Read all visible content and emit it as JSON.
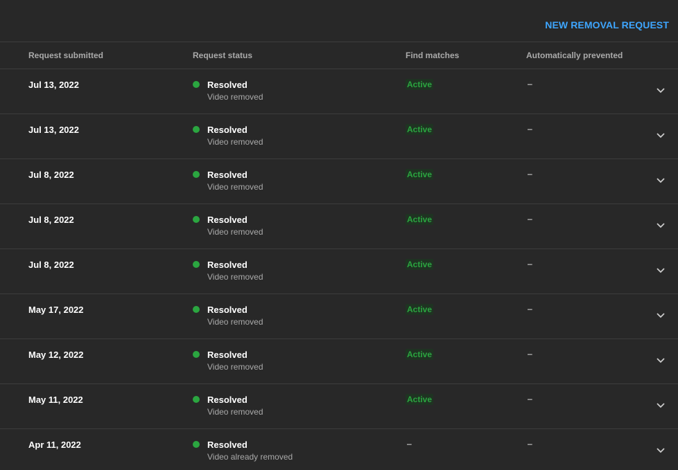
{
  "toolbar": {
    "new_request_label": "NEW REMOVAL REQUEST"
  },
  "table": {
    "columns": [
      "Request submitted",
      "Request status",
      "Find matches",
      "Automatically prevented"
    ],
    "rows": [
      {
        "date": "Jul 13, 2022",
        "status": "Resolved",
        "detail": "Video removed",
        "find_matches": "Active",
        "auto_prevented": "–"
      },
      {
        "date": "Jul 13, 2022",
        "status": "Resolved",
        "detail": "Video removed",
        "find_matches": "Active",
        "auto_prevented": "–"
      },
      {
        "date": "Jul 8, 2022",
        "status": "Resolved",
        "detail": "Video removed",
        "find_matches": "Active",
        "auto_prevented": "–"
      },
      {
        "date": "Jul 8, 2022",
        "status": "Resolved",
        "detail": "Video removed",
        "find_matches": "Active",
        "auto_prevented": "–"
      },
      {
        "date": "Jul 8, 2022",
        "status": "Resolved",
        "detail": "Video removed",
        "find_matches": "Active",
        "auto_prevented": "–"
      },
      {
        "date": "May 17, 2022",
        "status": "Resolved",
        "detail": "Video removed",
        "find_matches": "Active",
        "auto_prevented": "–"
      },
      {
        "date": "May 12, 2022",
        "status": "Resolved",
        "detail": "Video removed",
        "find_matches": "Active",
        "auto_prevented": "–"
      },
      {
        "date": "May 11, 2022",
        "status": "Resolved",
        "detail": "Video removed",
        "find_matches": "Active",
        "auto_prevented": "–"
      },
      {
        "date": "Apr 11, 2022",
        "status": "Resolved",
        "detail": "Video already removed",
        "find_matches": "–",
        "auto_prevented": "–"
      }
    ]
  },
  "icons": {
    "status": "status-dot-icon",
    "expand": "chevron-down-icon"
  },
  "colors": {
    "background": "#282828",
    "accent": "#3ea6ff",
    "status_green": "#2ba640",
    "divider": "#3d3d3d",
    "muted_text": "#aaaaaa"
  }
}
